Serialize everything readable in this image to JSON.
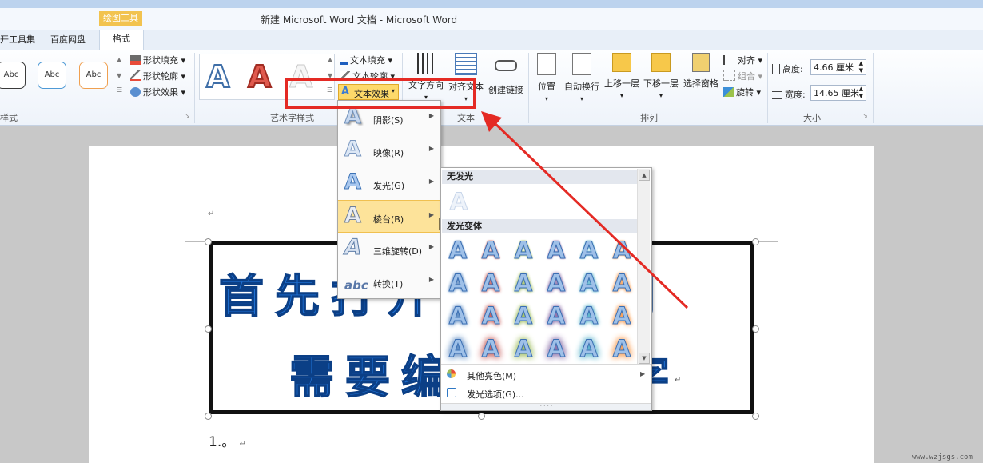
{
  "window": {
    "title": "新建 Microsoft Word 文档 - Microsoft Word",
    "context_tab_header": "绘图工具"
  },
  "tabs": [
    "开工具集",
    "百度网盘",
    "格式"
  ],
  "ribbon": {
    "shape_styles": {
      "label": "形状样式",
      "samples": [
        "Abc",
        "Abc",
        "Abc"
      ],
      "fill": "形状填充",
      "outline": "形状轮廓",
      "effects": "形状效果"
    },
    "wordart": {
      "label": "艺术字样式",
      "text_fill": "文本填充",
      "text_outline": "文本轮廓",
      "text_effects": "文本效果"
    },
    "text": {
      "label": "文本",
      "direction": "文字方向",
      "align": "对齐文本",
      "link": "创建链接"
    },
    "arrange": {
      "label": "排列",
      "position": "位置",
      "wrap": "自动换行",
      "forward": "上移一层",
      "backward": "下移一层",
      "selection_pane": "选择窗格",
      "align": "对齐",
      "group": "组合",
      "rotate": "旋转"
    },
    "size": {
      "label": "大小",
      "height_label": "高度:",
      "height_value": "4.66 厘米",
      "width_label": "宽度:",
      "width_value": "14.65 厘米"
    }
  },
  "effect_menu": {
    "items": [
      {
        "label": "阴影(S)",
        "icon": "shadow-a-icon"
      },
      {
        "label": "映像(R)",
        "icon": "reflection-a-icon"
      },
      {
        "label": "发光(G)",
        "icon": "glow-a-icon"
      },
      {
        "label": "棱台(B)",
        "icon": "bevel-a-icon"
      },
      {
        "label": "三维旋转(D)",
        "icon": "rotate3d-a-icon"
      },
      {
        "label": "转换(T)",
        "icon": "transform-abc-icon"
      }
    ]
  },
  "glow_panel": {
    "no_glow_header": "无发光",
    "variations_header": "发光变体",
    "glyph": "A",
    "glow_colors": [
      "#4f81bd",
      "#c0504d",
      "#9bbb59",
      "#8064a2",
      "#4bacc6",
      "#f79646"
    ],
    "more_colors": "其他亮色(M)",
    "options": "发光选项(G)..."
  },
  "document": {
    "line1": "首先打开需要找到",
    "line2": "需要编辑的文字",
    "list_line": "1.。",
    "paragraph_mark": "↵"
  },
  "watermark": "www.wzjsgs.com",
  "colors": {
    "annotation": "#e42a24",
    "wordart_blue": "#1e6fd1"
  }
}
